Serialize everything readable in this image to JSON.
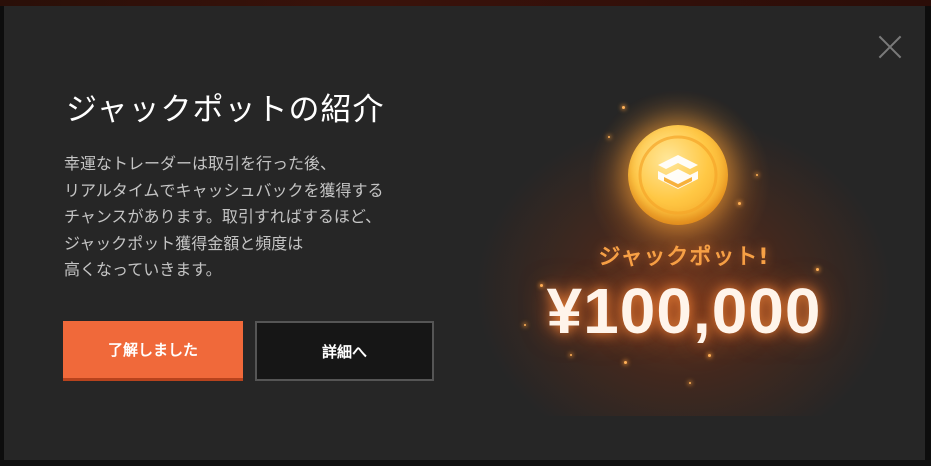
{
  "modal": {
    "title": "ジャックポットの紹介",
    "description_lines": [
      "幸運なトレーダーは取引を行った後、",
      "リアルタイムでキャッシュバックを獲得する",
      "チャンスがあります。取引すればするほど、",
      "ジャックポット獲得金額と頻度は",
      "高くなっていきます。"
    ],
    "buttons": {
      "primary_label": "了解しました",
      "secondary_label": "詳細へ"
    },
    "close_icon": "close-icon"
  },
  "illustration": {
    "coin_icon": "jackpot-coin-icon",
    "jackpot_label": "ジャックポット!",
    "amount": "¥100,000"
  },
  "colors": {
    "modal_background": "#262626",
    "primary_button": "#f0693a",
    "secondary_button": "#161616",
    "accent_orange": "#f7a045"
  }
}
